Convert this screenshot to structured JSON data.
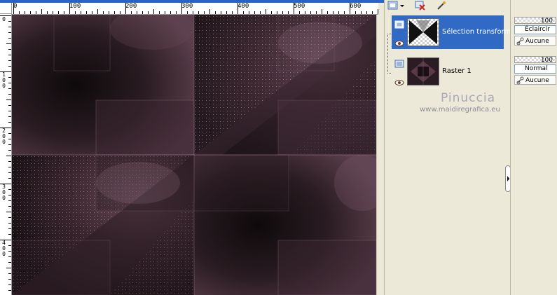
{
  "ruler": {
    "h_labels": [
      "0",
      "100",
      "200",
      "300",
      "400",
      "500",
      "600"
    ],
    "v_labels": [
      "0",
      "1\n0\n0",
      "2\n0\n0",
      "3\n0\n0",
      "4\n0\n0"
    ]
  },
  "canvas": {
    "colors": {
      "dark": "#1c1418",
      "plum": "#5a3a48",
      "mauve": "#7d5a6a",
      "highlight": "#a07a8c"
    }
  },
  "layers_panel": {
    "toolbar_icons": [
      "new-layer-icon",
      "dropdown-arrow-icon",
      "delete-layer-icon",
      "edit-layer-icon"
    ],
    "layers": [
      {
        "name": "Sélection transformée",
        "selected": true,
        "icon": "vector-layer-icon",
        "visibility_icon": "eye-icon"
      },
      {
        "name": "Raster 1",
        "selected": false,
        "icon": "raster-layer-icon",
        "visibility_icon": "eye-icon"
      }
    ],
    "watermark": {
      "name": "Pinuccia",
      "url": "www.maidiregrafica.eu"
    }
  },
  "properties_panel": {
    "blocks": [
      {
        "opacity": "100",
        "blend_mode": "Éclaircir",
        "mask": "Aucune"
      },
      {
        "opacity": "100",
        "blend_mode": "Normal",
        "mask": "Aucune"
      }
    ]
  }
}
